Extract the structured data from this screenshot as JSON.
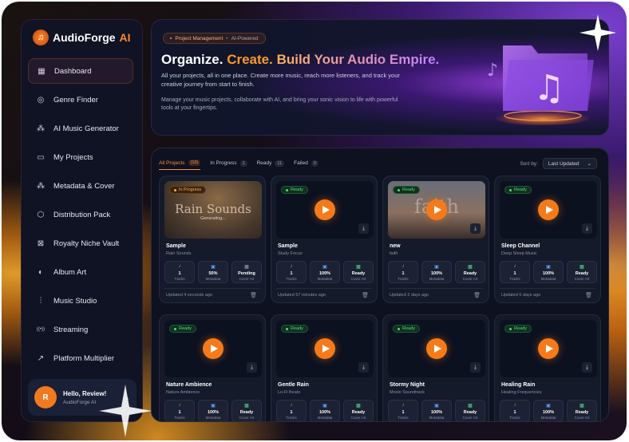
{
  "app": {
    "name_main": "AudioForge",
    "name_ai": "AI"
  },
  "sidebar": {
    "items": [
      {
        "label": "Dashboard",
        "icon": "dashboard-icon",
        "active": true
      },
      {
        "label": "Genre Finder",
        "icon": "compass-icon"
      },
      {
        "label": "AI Music Generator",
        "icon": "magic-wand-icon"
      },
      {
        "label": "My Projects",
        "icon": "folder-icon"
      },
      {
        "label": "Metadata & Cover",
        "icon": "magic-wand-icon"
      },
      {
        "label": "Distribution Pack",
        "icon": "package-icon"
      },
      {
        "label": "Royalty Niche Vault",
        "icon": "vault-icon"
      },
      {
        "label": "Album Art",
        "icon": "palette-icon"
      },
      {
        "label": "Music Studio",
        "icon": "sliders-icon"
      },
      {
        "label": "Streaming",
        "icon": "broadcast-icon"
      },
      {
        "label": "Platform Multiplier",
        "icon": "trend-up-icon"
      }
    ]
  },
  "user": {
    "initial": "R",
    "greeting": "Hello, Review!",
    "sub": "AudioForge AI"
  },
  "hero": {
    "pill_main": "Project Management",
    "pill_sep": "•",
    "pill_sub": "AI-Powered",
    "title_1": "Organize.",
    "title_2": "Create.",
    "title_3": "Build Your Audio Empire.",
    "para_1": "All your projects, all in one place. Create more music, reach more listeners, and track your creative journey from start to finish.",
    "para_2": "Manage your music projects, collaborate with AI, and bring your sonic vision to life with powerful tools at your fingertips."
  },
  "tabs": [
    {
      "label": "All Projects",
      "count": "(10)",
      "active": true
    },
    {
      "label": "In Progress",
      "count": "1"
    },
    {
      "label": "Ready",
      "count": "11"
    },
    {
      "label": "Failed",
      "count": "0"
    }
  ],
  "sort": {
    "label": "Sort by:",
    "value": "Last Updated"
  },
  "cards": [
    {
      "title": "Sample",
      "subtitle": "Rain Sounds",
      "status": "In Progress",
      "thumb_text": "Rain Sounds",
      "thumb_sub": "Generating...",
      "tracks": "1",
      "metadata": "50%",
      "cover": "Pending",
      "updated": "Updated 4 seconds ago"
    },
    {
      "title": "Sample",
      "subtitle": "Study Focus",
      "status": "Ready",
      "tracks": "1",
      "metadata": "100%",
      "cover": "Ready",
      "updated": "Updated 57 minutes ago"
    },
    {
      "title": "new",
      "subtitle": "faith",
      "status": "Ready",
      "thumb_text": "faith",
      "tracks": "1",
      "metadata": "100%",
      "cover": "Ready",
      "updated": "Updated 2 days ago"
    },
    {
      "title": "Sleep Channel",
      "subtitle": "Deep Sleep Music",
      "status": "Ready",
      "tracks": "1",
      "metadata": "100%",
      "cover": "Ready",
      "updated": "Updated 6 days ago"
    },
    {
      "title": "Nature Ambience",
      "subtitle": "Nature Ambience",
      "status": "Ready",
      "tracks": "1",
      "metadata": "100%",
      "cover": "Ready"
    },
    {
      "title": "Gentle Rain",
      "subtitle": "Lo-Fi Beats",
      "status": "Ready",
      "tracks": "1",
      "metadata": "100%",
      "cover": "Ready"
    },
    {
      "title": "Stormy Night",
      "subtitle": "Movie Soundtrack",
      "status": "Ready",
      "tracks": "1",
      "metadata": "100%",
      "cover": "Ready"
    },
    {
      "title": "Healing Rain",
      "subtitle": "Healing Frequencies",
      "status": "Ready",
      "tracks": "1",
      "metadata": "100%",
      "cover": "Ready"
    }
  ],
  "stat_labels": {
    "tracks": "Tracks",
    "metadata": "Metadata",
    "cover": "Cover Art"
  },
  "colors": {
    "accent": "#f57a1a",
    "ready": "#4ade80",
    "sidebar_bg": "#0f1324"
  }
}
